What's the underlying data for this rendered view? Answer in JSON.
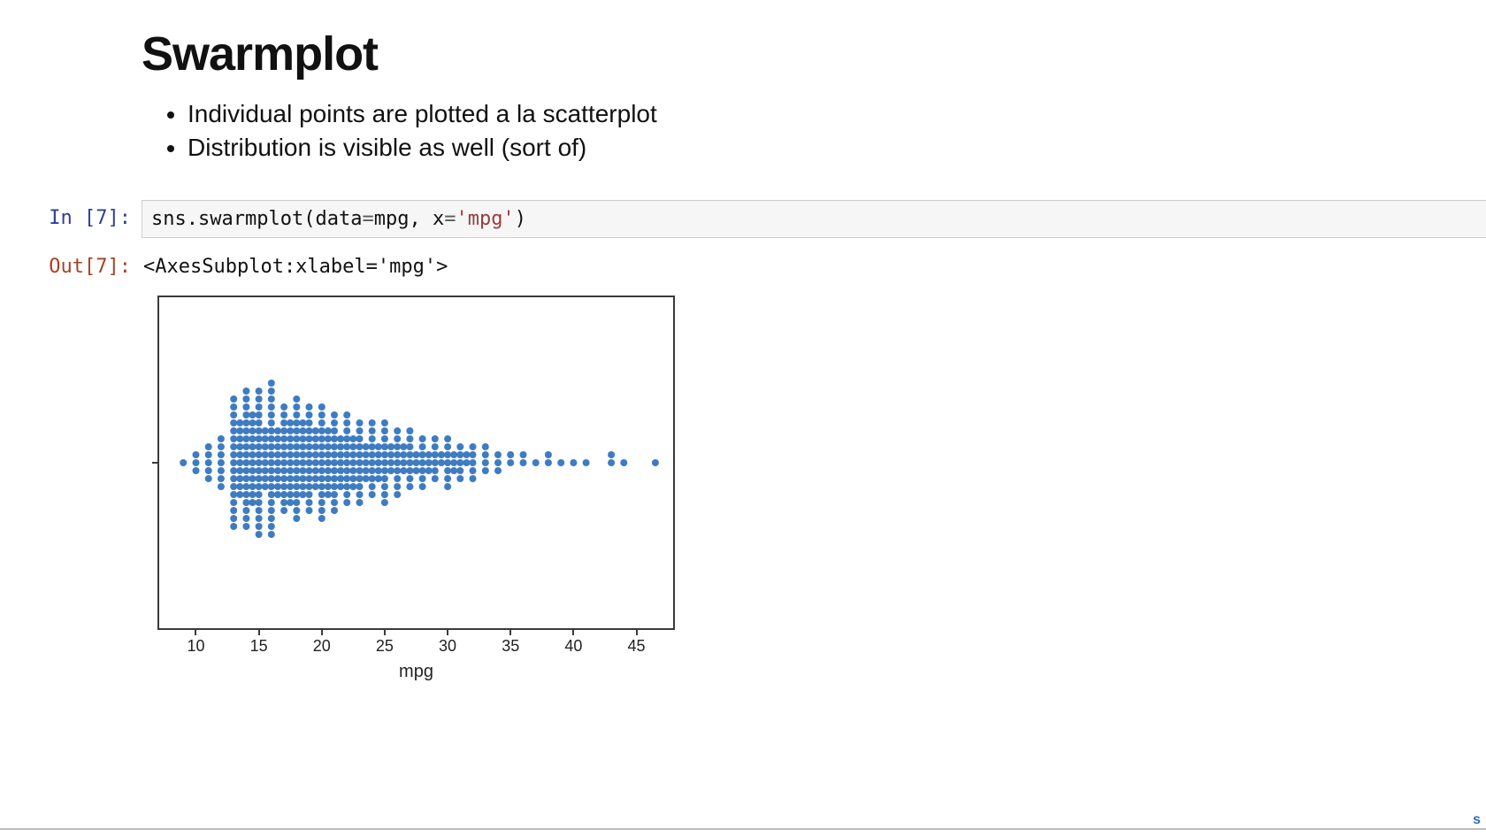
{
  "heading": "Swarmplot",
  "bullets": [
    "Individual points are plotted a la scatterplot",
    "Distribution is visible as well (sort of)"
  ],
  "cell_in_prompt": "In [7]:",
  "cell_out_prompt": "Out[7]:",
  "code_tokens": {
    "t0": "sns",
    "t1": ".",
    "t2": "swarmplot",
    "t3": "(",
    "t4": "data",
    "t5": "=",
    "t6": "mpg",
    "t7": ", ",
    "t8": "x",
    "t9": "=",
    "t10": "'mpg'",
    "t11": ")"
  },
  "output_text": "<AxesSubplot:xlabel='mpg'>",
  "chart_data": {
    "type": "swarm",
    "xlabel": "mpg",
    "ylabel": "",
    "xticks": [
      10,
      15,
      20,
      25,
      30,
      35,
      40,
      45
    ],
    "xlim": [
      8,
      47
    ],
    "point_color": "#3e7cc2",
    "point_radius": 4,
    "note": "Counts are approximate readings of stacked-dot column heights from the swarmplot image.",
    "marginal_counts": [
      {
        "x": 9,
        "n": 1
      },
      {
        "x": 10,
        "n": 3
      },
      {
        "x": 11,
        "n": 5
      },
      {
        "x": 12,
        "n": 7
      },
      {
        "x": 13,
        "n": 17
      },
      {
        "x": 13.5,
        "n": 10
      },
      {
        "x": 14,
        "n": 18
      },
      {
        "x": 14.5,
        "n": 12
      },
      {
        "x": 15,
        "n": 19
      },
      {
        "x": 15.5,
        "n": 8
      },
      {
        "x": 16,
        "n": 20
      },
      {
        "x": 16.5,
        "n": 9
      },
      {
        "x": 17,
        "n": 14
      },
      {
        "x": 17.5,
        "n": 11
      },
      {
        "x": 18,
        "n": 16
      },
      {
        "x": 18.5,
        "n": 10
      },
      {
        "x": 19,
        "n": 14
      },
      {
        "x": 19.5,
        "n": 8
      },
      {
        "x": 20,
        "n": 15
      },
      {
        "x": 20.5,
        "n": 9
      },
      {
        "x": 21,
        "n": 13
      },
      {
        "x": 21.5,
        "n": 7
      },
      {
        "x": 22,
        "n": 12
      },
      {
        "x": 22.5,
        "n": 7
      },
      {
        "x": 23,
        "n": 11
      },
      {
        "x": 23.5,
        "n": 5
      },
      {
        "x": 24,
        "n": 10
      },
      {
        "x": 24.5,
        "n": 5
      },
      {
        "x": 25,
        "n": 11
      },
      {
        "x": 25.5,
        "n": 4
      },
      {
        "x": 26,
        "n": 9
      },
      {
        "x": 26.5,
        "n": 4
      },
      {
        "x": 27,
        "n": 8
      },
      {
        "x": 27.5,
        "n": 3
      },
      {
        "x": 28,
        "n": 7
      },
      {
        "x": 28.5,
        "n": 3
      },
      {
        "x": 29,
        "n": 6
      },
      {
        "x": 29.5,
        "n": 2
      },
      {
        "x": 30,
        "n": 7
      },
      {
        "x": 30.5,
        "n": 3
      },
      {
        "x": 31,
        "n": 5
      },
      {
        "x": 31.5,
        "n": 2
      },
      {
        "x": 32,
        "n": 5
      },
      {
        "x": 33,
        "n": 4
      },
      {
        "x": 34,
        "n": 3
      },
      {
        "x": 35,
        "n": 2
      },
      {
        "x": 36,
        "n": 2
      },
      {
        "x": 37,
        "n": 1
      },
      {
        "x": 38,
        "n": 2
      },
      {
        "x": 39,
        "n": 1
      },
      {
        "x": 40,
        "n": 1
      },
      {
        "x": 41,
        "n": 1
      },
      {
        "x": 43,
        "n": 2
      },
      {
        "x": 44,
        "n": 1
      },
      {
        "x": 46.5,
        "n": 1
      }
    ]
  },
  "corner_letter": "s"
}
